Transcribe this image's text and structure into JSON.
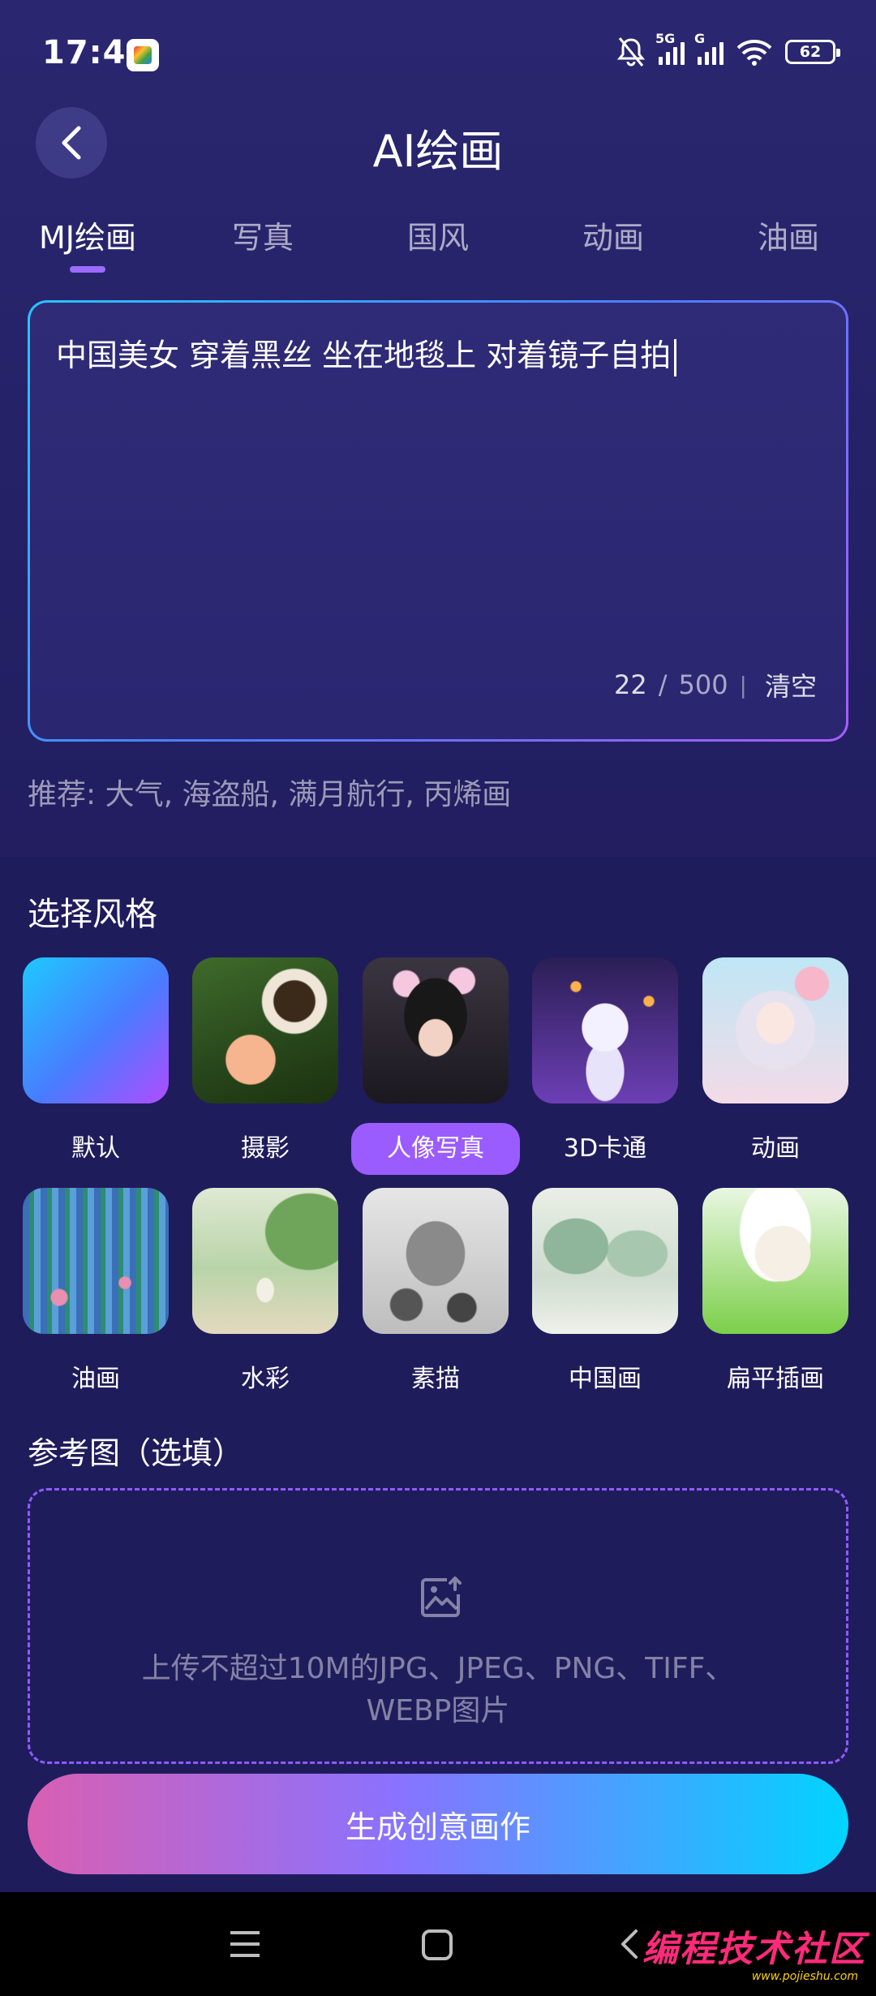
{
  "status_bar": {
    "time": "17:41",
    "network_1": "5G",
    "network_2": "G",
    "battery": "62"
  },
  "header": {
    "title": "AI绘画"
  },
  "tabs": [
    {
      "label": "MJ绘画",
      "active": true
    },
    {
      "label": "写真",
      "active": false
    },
    {
      "label": "国风",
      "active": false
    },
    {
      "label": "动画",
      "active": false
    },
    {
      "label": "油画",
      "active": false
    }
  ],
  "prompt": {
    "text": "中国美女 穿着黑丝 坐在地毯上 对着镜子自拍",
    "count": "22",
    "slash": "/",
    "max": "500",
    "divider": "|",
    "clear_label": "清空"
  },
  "recommend": "推荐: 大气, 海盗船, 满月航行, 丙烯画",
  "styles": {
    "title": "选择风格",
    "items": [
      {
        "label": "默认",
        "thumb": "t-default",
        "active": false
      },
      {
        "label": "摄影",
        "thumb": "t-photo",
        "active": false
      },
      {
        "label": "人像写真",
        "thumb": "t-portrait",
        "active": true
      },
      {
        "label": "3D卡通",
        "thumb": "t-3d",
        "active": false
      },
      {
        "label": "动画",
        "thumb": "t-anime",
        "active": false
      },
      {
        "label": "油画",
        "thumb": "t-oil",
        "active": false
      },
      {
        "label": "水彩",
        "thumb": "t-water",
        "active": false
      },
      {
        "label": "素描",
        "thumb": "t-sketch",
        "active": false
      },
      {
        "label": "中国画",
        "thumb": "t-chinese",
        "active": false
      },
      {
        "label": "扁平插画",
        "thumb": "t-flat",
        "active": false
      }
    ]
  },
  "reference": {
    "title": "参考图（选填）",
    "upload_line1": "上传不超过10M的JPG、JPEG、PNG、TIFF、",
    "upload_line2": "WEBP图片"
  },
  "generate_label": "生成创意画作",
  "watermark": {
    "text": "编程技术社区",
    "sub": "www.pojieshu.com"
  },
  "colors": {
    "accent": "#9b5cff",
    "gradient_start": "#d95fb2",
    "gradient_end": "#00d4ff"
  }
}
